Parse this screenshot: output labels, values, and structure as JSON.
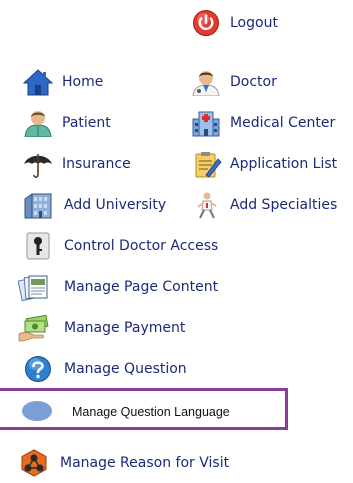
{
  "header": {
    "logout_label": "Logout"
  },
  "menu": {
    "home": "Home",
    "doctor": "Doctor",
    "patient": "Patient",
    "medical_center": "Medical Center",
    "insurance": "Insurance",
    "application_list": "Application List",
    "add_university": "Add University",
    "add_specialties": "Add Specialties",
    "control_doctor_access": "Control Doctor Access",
    "manage_page_content": "Manage Page Content",
    "manage_payment": "Manage Payment",
    "manage_question": "Manage Question",
    "manage_question_language": "Manage Question Language",
    "manage_reason_for_visit": "Manage Reason for Visit"
  },
  "highlight_color": "#8a3b9b",
  "icons": [
    "power-icon",
    "home-icon",
    "doctor-icon",
    "patient-icon",
    "hospital-building-icon",
    "umbrella-icon",
    "clipboard-pen-icon",
    "university-building-icon",
    "running-doctor-icon",
    "key-icon",
    "documents-icon",
    "money-hand-icon",
    "help-question-icon",
    "blue-oval-icon",
    "hexagon-nodes-icon"
  ]
}
